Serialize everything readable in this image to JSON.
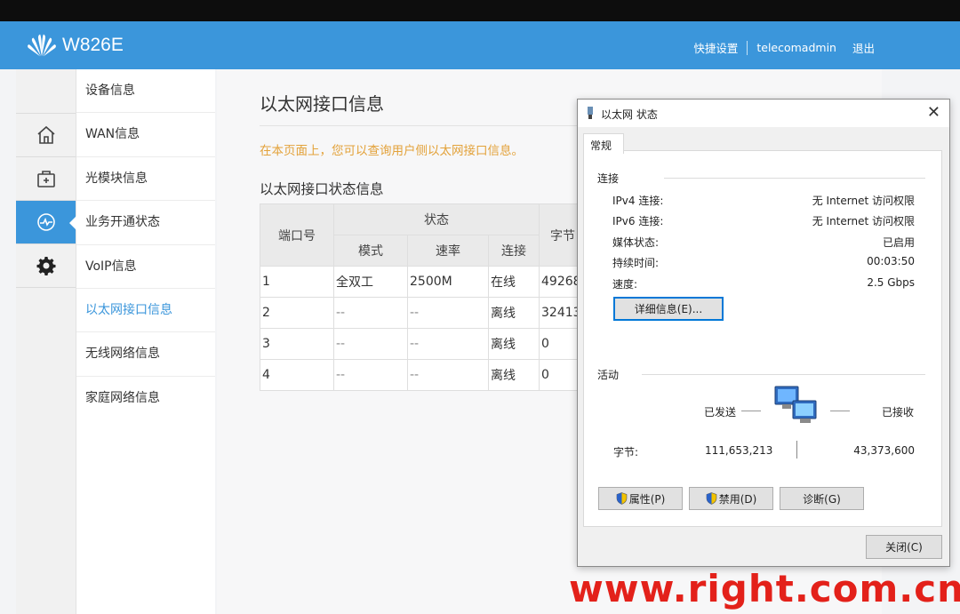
{
  "header": {
    "product": "W826E",
    "links": [
      "快捷设置",
      "telecomadmin",
      "退出"
    ],
    "bg_color": "#3b96db"
  },
  "icon_nav": [
    "home-icon",
    "toolbox-icon",
    "status-pulse-icon",
    "gear-icon"
  ],
  "submenu": {
    "items": [
      "设备信息",
      "WAN信息",
      "光模块信息",
      "业务开通状态",
      "VoIP信息",
      "以太网接口信息",
      "无线网络信息",
      "家庭网络信息"
    ],
    "active_index": 5
  },
  "main": {
    "title": "以太网接口信息",
    "notice": "在本页面上，您可以查询用户侧以太网接口信息。",
    "section_title": "以太网接口状态信息",
    "table": {
      "port_header": "端口号",
      "status_header": "状态",
      "columns": [
        "模式",
        "速率",
        "连接",
        "字节"
      ],
      "rows": [
        [
          "1",
          "全双工",
          "2500M",
          "在线",
          "49268("
        ],
        [
          "2",
          "--",
          "--",
          "离线",
          "32413"
        ],
        [
          "3",
          "--",
          "--",
          "离线",
          "0"
        ],
        [
          "4",
          "--",
          "--",
          "离线",
          "0"
        ]
      ]
    }
  },
  "dialog": {
    "title": "以太网 状态",
    "tab": "常规",
    "connection_label": "连接",
    "rows": [
      {
        "label": "IPv4 连接:",
        "value": "无 Internet 访问权限"
      },
      {
        "label": "IPv6 连接:",
        "value": "无 Internet 访问权限"
      },
      {
        "label": "媒体状态:",
        "value": "已启用"
      },
      {
        "label": "持续时间:",
        "value": "00:03:50"
      },
      {
        "label": "速度:",
        "value": "2.5 Gbps"
      }
    ],
    "details_button": "详细信息(E)...",
    "activity_label": "活动",
    "sent_label": "已发送",
    "received_label": "已接收",
    "bytes_label": "字节:",
    "bytes_sent": "111,653,213",
    "bytes_received": "43,373,600",
    "buttons": [
      "属性(P)",
      "禁用(D)",
      "诊断(G)"
    ],
    "close_button": "关闭(C)"
  },
  "watermark": "www.right.com.cn"
}
